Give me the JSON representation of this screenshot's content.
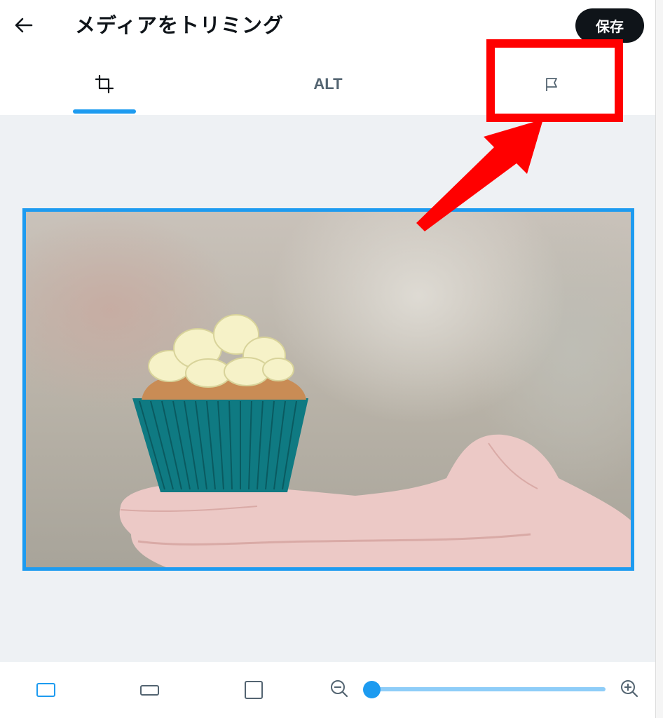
{
  "header": {
    "back_icon": "arrow-left-icon",
    "title": "メディアをトリミング",
    "save_label": "保存"
  },
  "tabs": [
    {
      "id": "crop",
      "icon": "crop-icon",
      "selected": true
    },
    {
      "id": "alt",
      "label": "ALT",
      "selected": false
    },
    {
      "id": "flag",
      "icon": "flag-icon",
      "selected": false
    }
  ],
  "editor": {
    "image_subject": "cupcake-on-hand-photo"
  },
  "toolbar": {
    "aspect_ratios": [
      {
        "id": "original",
        "icon": "aspect-original-icon",
        "selected": true
      },
      {
        "id": "wide",
        "icon": "aspect-wide-icon",
        "selected": false
      },
      {
        "id": "square",
        "icon": "aspect-square-icon",
        "selected": false
      }
    ],
    "zoom_out_icon": "zoom-out-icon",
    "zoom_in_icon": "zoom-in-icon",
    "zoom_level": 0
  },
  "annotation": {
    "color": "#ff0000",
    "target": "flag-tab"
  },
  "colors": {
    "accent": "#1d9bf0",
    "accent_light": "#8ecdf8",
    "canvas_bg": "#eef1f4",
    "text_primary": "#0f1419",
    "text_secondary": "#536471"
  }
}
